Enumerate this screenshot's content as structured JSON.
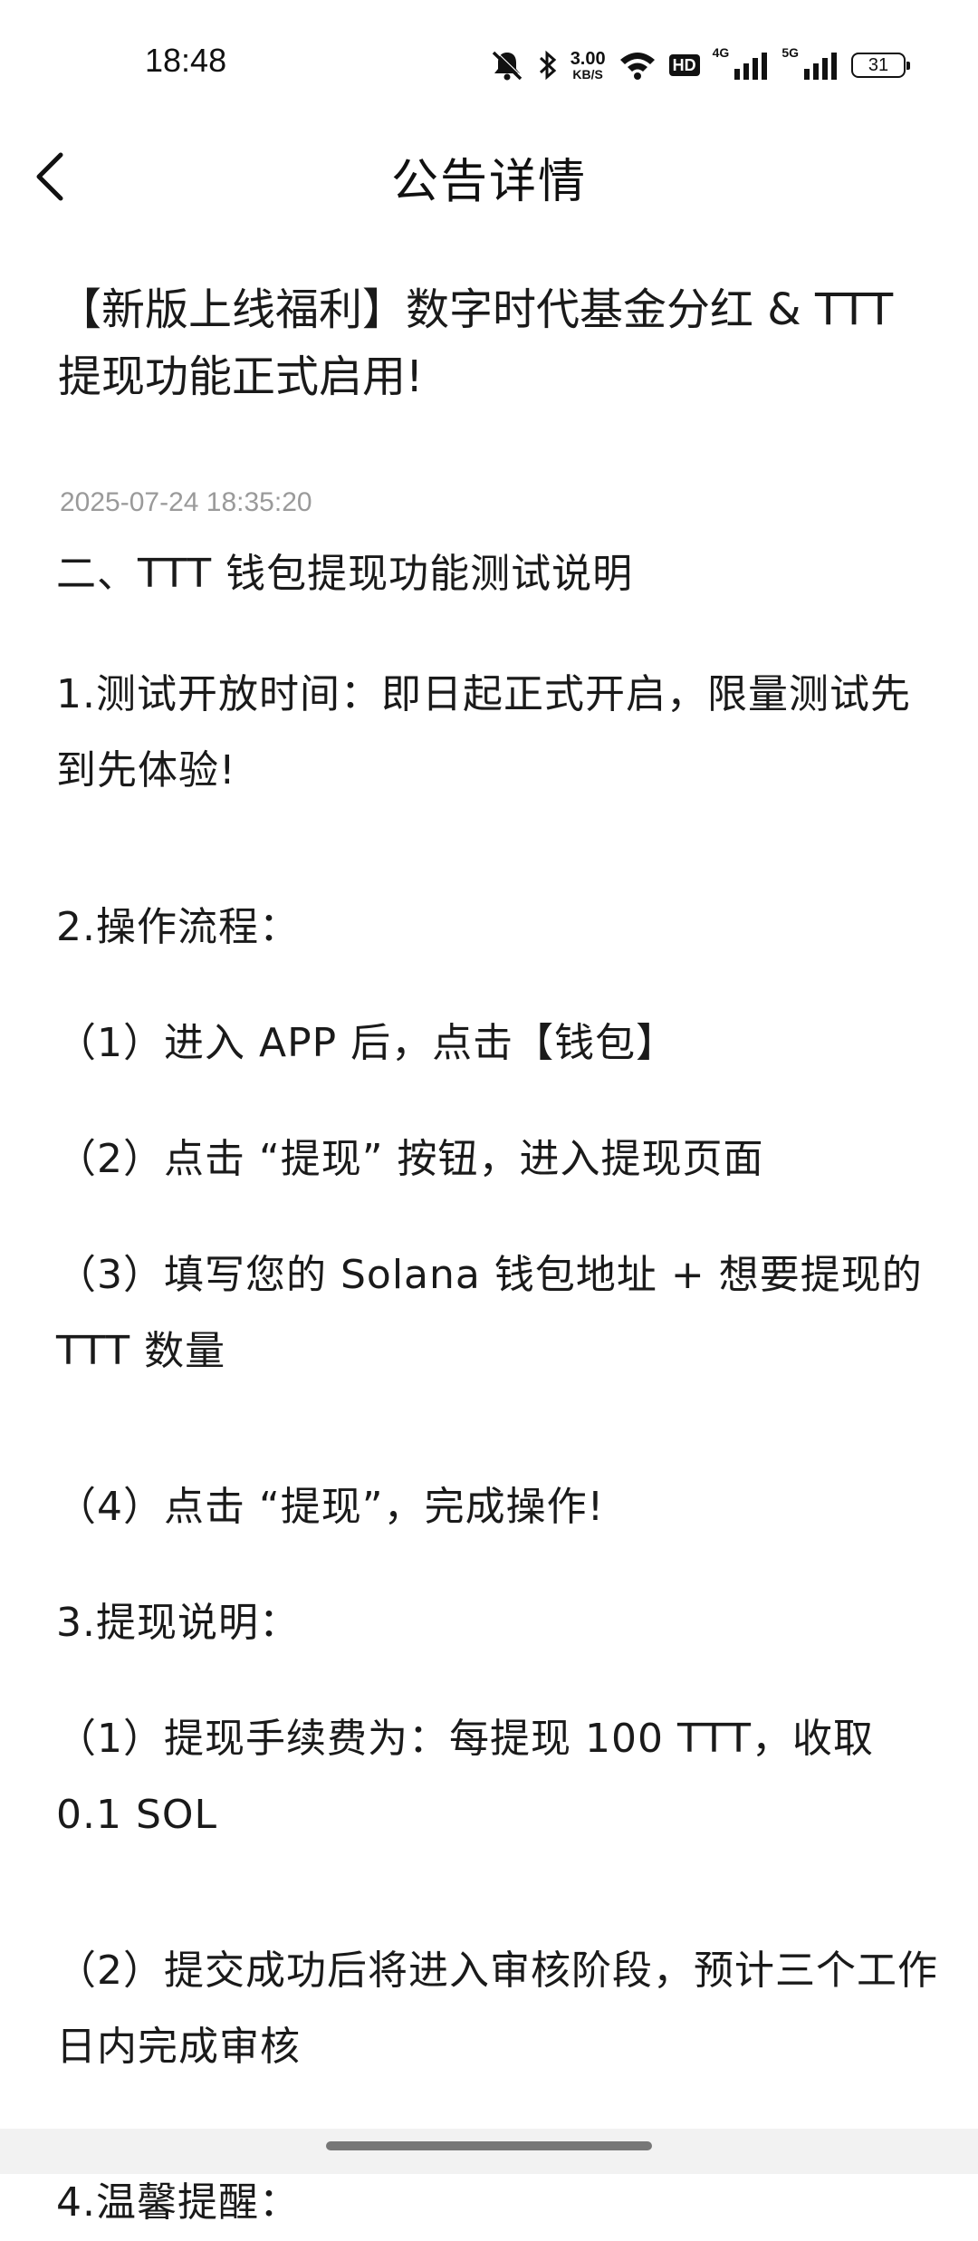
{
  "status_bar": {
    "time": "18:48",
    "net_speed_value": "3.00",
    "net_speed_unit": "KB/S",
    "hd_label": "HD",
    "sig1_label": "4G",
    "sig2_label": "5G",
    "battery": "31",
    "icons": [
      "mute-bell-icon",
      "bluetooth-icon",
      "wifi-icon",
      "signal-icon",
      "battery-icon"
    ]
  },
  "header": {
    "title": "公告详情"
  },
  "article": {
    "title": "【新版上线福利】数字时代基金分红 & TTT提现功能正式启用!",
    "date": "2025-07-24 18:35:20",
    "paragraphs": [
      "二、TTT 钱包提现功能测试说明",
      "1.测试开放时间：即日起正式开启，限量测试先到先体验!",
      "2.操作流程：",
      "（1）进入 APP 后，点击【钱包】",
      "（2）点击 “提现” 按钮，进入提现页面",
      "（3）填写您的 Solana 钱包地址 + 想要提现的 TTT 数量",
      "（4）点击 “提现”，完成操作!",
      "3.提现说明：",
      "（1）提现手续费为：每提现 100 TTT，收取 0.1 SOL",
      "（2）提交成功后将进入审核阶段，预计三个工作日内完成审核",
      "4.温馨提醒："
    ]
  }
}
